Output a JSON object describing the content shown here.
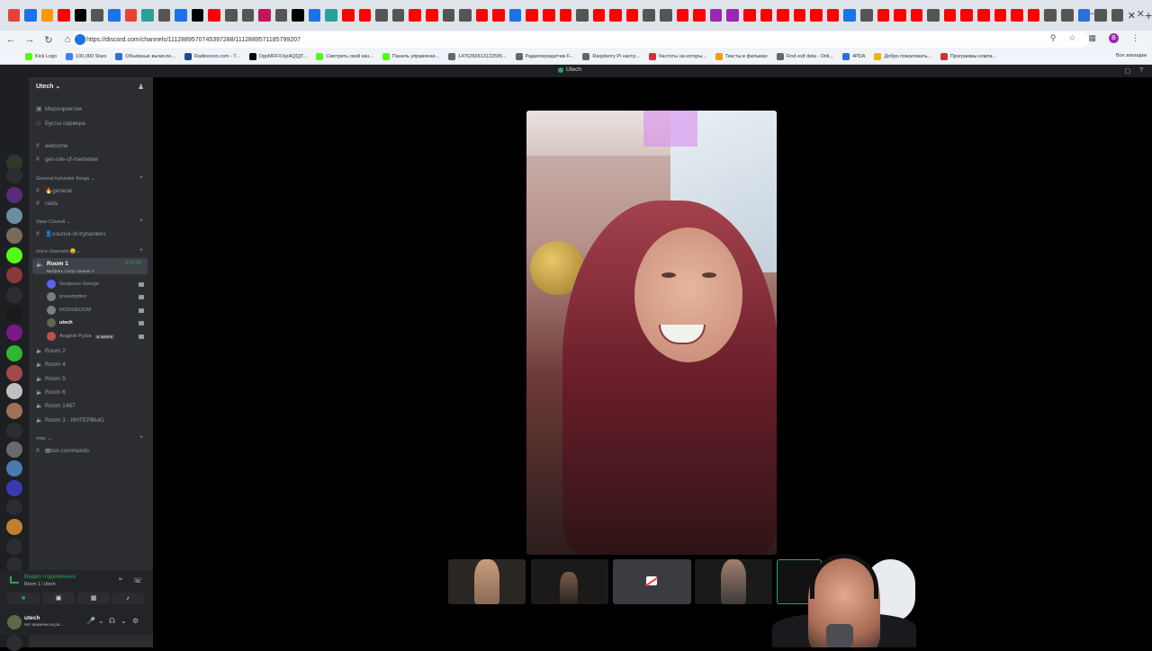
{
  "browser": {
    "url": "https://discord.com/channels/1112889570745397288/1112889571185799207",
    "bookmarks": [
      {
        "label": "Kick Logo",
        "color": "#53fc18"
      },
      {
        "label": "100,000 Stars",
        "color": "#3b82f6"
      },
      {
        "label": "Объёмные вычисле...",
        "color": "#2a6fdb"
      },
      {
        "label": "Radiooooo.com - T...",
        "color": "#1b4b8a"
      },
      {
        "label": "OgoMFFXXjzAQQjT...",
        "color": "#000000"
      },
      {
        "label": "Смотреть свой кан...",
        "color": "#53fc18"
      },
      {
        "label": "Панель управлени...",
        "color": "#53fc18"
      },
      {
        "label": "1476282613122595...",
        "color": "#666666"
      },
      {
        "label": "Радиопередатчик F...",
        "color": "#666666"
      },
      {
        "label": "Raspberry Pi настр...",
        "color": "#666666"
      },
      {
        "label": "Частоты на которы...",
        "color": "#cc3333"
      },
      {
        "label": "Тексты в фильмах",
        "color": "#f39c12"
      },
      {
        "label": "Find exif data - Onli...",
        "color": "#666666"
      },
      {
        "label": "4PDA",
        "color": "#2a6fdb"
      },
      {
        "label": "Добро пожаловать...",
        "color": "#e6b800"
      },
      {
        "label": "Программы компа...",
        "color": "#cc3333"
      }
    ],
    "all_bookmarks": "Все закладки",
    "profile_initial": "B"
  },
  "discord": {
    "window_title": "Utech",
    "server_name": "Utech",
    "top_items": [
      {
        "label": "Мероприятия"
      },
      {
        "label": "Бусты сервера"
      }
    ],
    "channels_top": [
      "welcome",
      "get-role-of-memeber"
    ],
    "categories": {
      "general_tryharder": "General tryharder things",
      "valar": "Valar Counsil",
      "voice": "voice channels",
      "misc": "misc"
    },
    "channels_general": [
      "general",
      "raids"
    ],
    "channels_valar": [
      "council-of-tryharders"
    ],
    "active_room": {
      "name": "Room 1",
      "timer": "5:47:00",
      "status": "Выбрать статус канала"
    },
    "voice_users": [
      {
        "name": "Gorgeous George",
        "bold": false,
        "color": "#5865f2"
      },
      {
        "name": "presumption",
        "bold": false,
        "color": "#7a7d85"
      },
      {
        "name": "RODIGBOOM",
        "bold": false,
        "color": "#7a7d85"
      },
      {
        "name": "utech",
        "bold": true,
        "color": "#5a6b4a"
      },
      {
        "name": "Андрей Рузов",
        "bold": false,
        "color": "#c0504d",
        "badge": "В ЭФИРЕ"
      }
    ],
    "other_rooms": [
      "Room 2",
      "Room 4",
      "Room 5",
      "Room 6",
      "Room 1487",
      "Room 3 - ИНТЕРВЬЮ"
    ],
    "misc_channels": [
      "bot-commands"
    ],
    "voice_panel": {
      "status": "Видео подключено",
      "room": "Room 1 / Utech"
    },
    "user": {
      "name": "utech",
      "status": "Нет времени на ра..."
    }
  },
  "colors": {
    "accent_green": "#23a55a",
    "discord_bg": "#2b2d31",
    "rail_bg": "#1e1f22"
  }
}
